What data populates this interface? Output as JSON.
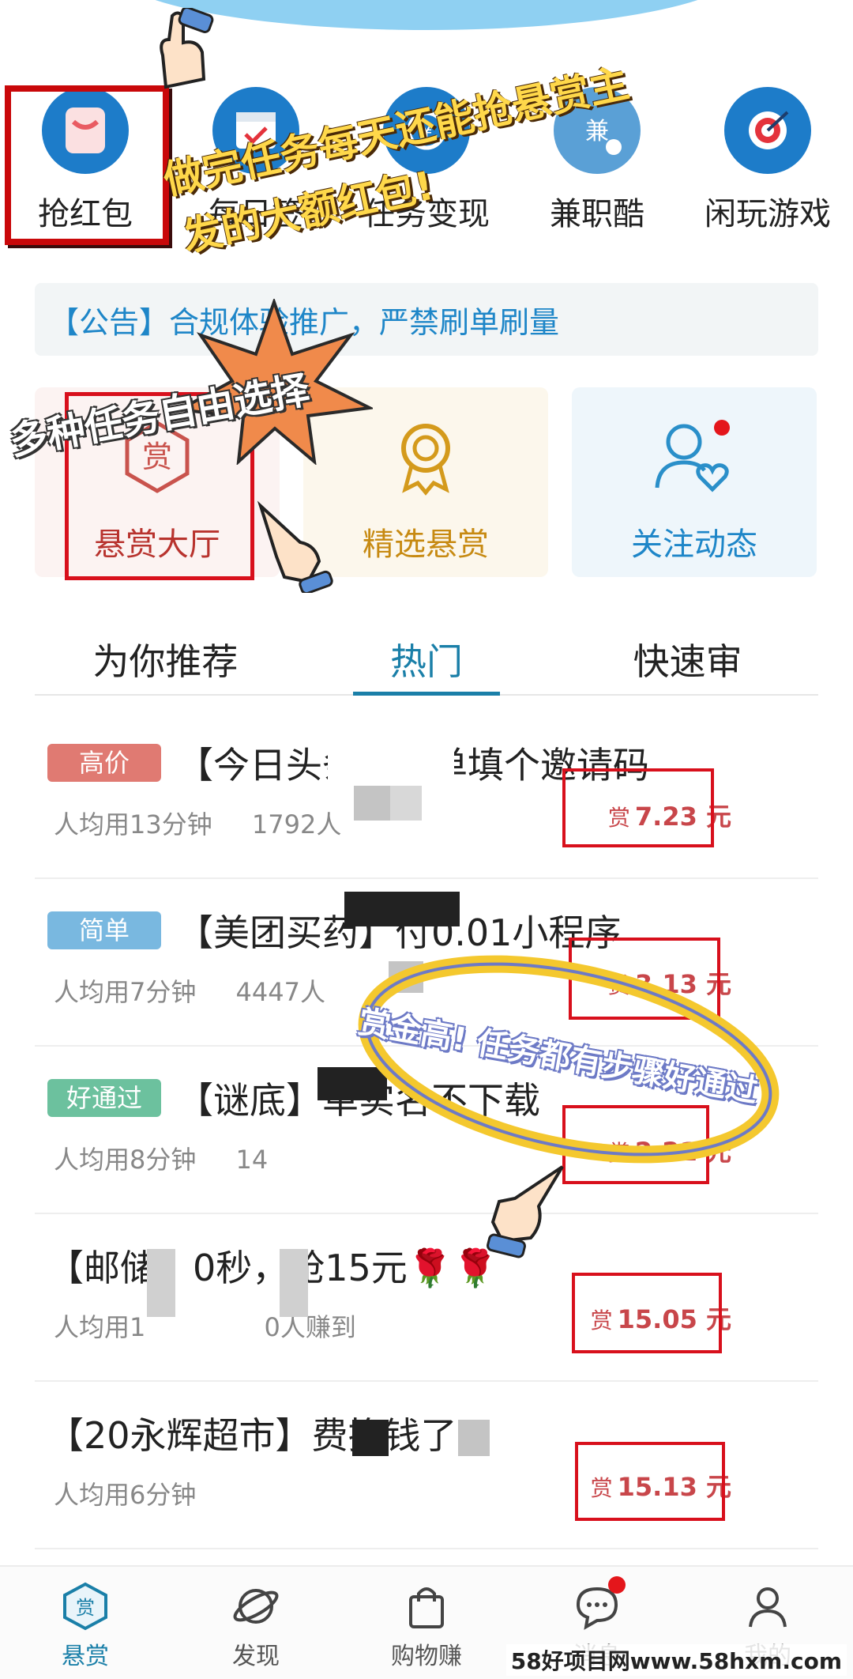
{
  "quick_actions": [
    {
      "label": "抢红包",
      "icon": "red-envelope-icon"
    },
    {
      "label": "每日签",
      "icon": "calendar-check-icon"
    },
    {
      "label": "任务变现",
      "icon": "coin-icon"
    },
    {
      "label": "兼职酷",
      "icon": "part-time-icon"
    },
    {
      "label": "闲玩游戏",
      "icon": "target-icon"
    }
  ],
  "notice": {
    "text": "【公告】合规体验推广，严禁刷单刷量"
  },
  "cards": [
    {
      "label": "悬赏大厅",
      "icon": "shang-hexagon-icon"
    },
    {
      "label": "精选悬赏",
      "icon": "medal-icon"
    },
    {
      "label": "关注动态",
      "icon": "follow-user-icon"
    }
  ],
  "tabs": [
    "为你推荐",
    "热门",
    "快速审"
  ],
  "active_tab": "热门",
  "tasks": [
    {
      "tag": "高价",
      "tag_color": "#e07a72",
      "title": "【今日头条】简单填个邀请码",
      "time": "人均用13分钟",
      "earned": "1792人",
      "reward_prefix": "赏",
      "reward": "7.23 元"
    },
    {
      "tag": "简单",
      "tag_color": "#79b8e0",
      "title": "【美团买药】付0.01小程序",
      "time": "人均用7分钟",
      "earned": "4447人",
      "reward_prefix": "赏",
      "reward": "3.13 元"
    },
    {
      "tag": "好通过",
      "tag_color": "#6cc19e",
      "title": "【谜底】单实名不下载",
      "time": "人均用8分钟",
      "earned": "14",
      "reward_prefix": "赏",
      "reward": "2.21 元"
    },
    {
      "tag": "",
      "tag_color": "",
      "title": "【邮储】0秒，抢15元🌹🌹",
      "time": "人均用1",
      "earned": "0人赚到",
      "reward_prefix": "赏",
      "reward": "15.05 元"
    },
    {
      "tag": "",
      "tag_color": "",
      "title": "【20永辉超市】费换钱了",
      "time": "人均用6分钟",
      "earned": "",
      "reward_prefix": "赏",
      "reward": "15.13 元"
    }
  ],
  "overlays": {
    "promo_top_line1": "做完任务每天还能抢悬赏主",
    "promo_top_line2": "发的大额红包!",
    "promo_mid": "多种任务自由选择",
    "promo_bottom": "赏金高! 任务都有步骤好通过"
  },
  "bottom_nav": [
    {
      "label": "悬赏",
      "icon": "shang-hexagon-icon"
    },
    {
      "label": "发现",
      "icon": "planet-icon"
    },
    {
      "label": "购物赚",
      "icon": "shopping-bag-icon"
    },
    {
      "label": "消息",
      "icon": "chat-bubble-icon"
    },
    {
      "label": "我的",
      "icon": "user-icon"
    }
  ],
  "watermark": "58好项目网www.58hxm.com",
  "colors": {
    "accent": "#1a7fa8",
    "reward_red": "#c8464a",
    "highlight_box": "#d8101c"
  }
}
